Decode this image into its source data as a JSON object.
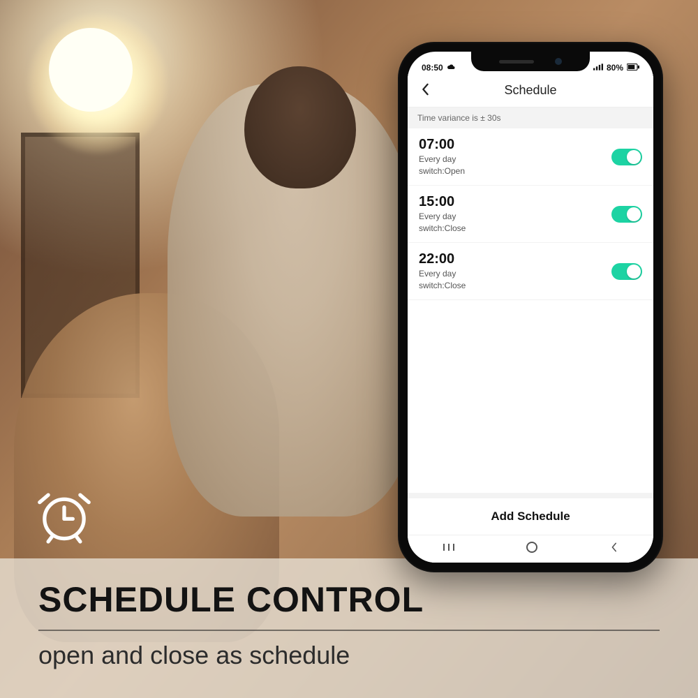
{
  "banner": {
    "title": "SCHEDULE CONTROL",
    "subtitle": "open and close as schedule"
  },
  "status_bar": {
    "time": "08:50",
    "battery": "80%"
  },
  "app": {
    "title": "Schedule",
    "note": "Time variance is ± 30s",
    "add_button": "Add Schedule"
  },
  "schedule": [
    {
      "time": "07:00",
      "repeat": "Every day",
      "action": "switch:Open",
      "enabled": true
    },
    {
      "time": "15:00",
      "repeat": "Every day",
      "action": "switch:Close",
      "enabled": true
    },
    {
      "time": "22:00",
      "repeat": "Every day",
      "action": "switch:Close",
      "enabled": true
    }
  ],
  "colors": {
    "toggle_on": "#1dd3a3"
  }
}
